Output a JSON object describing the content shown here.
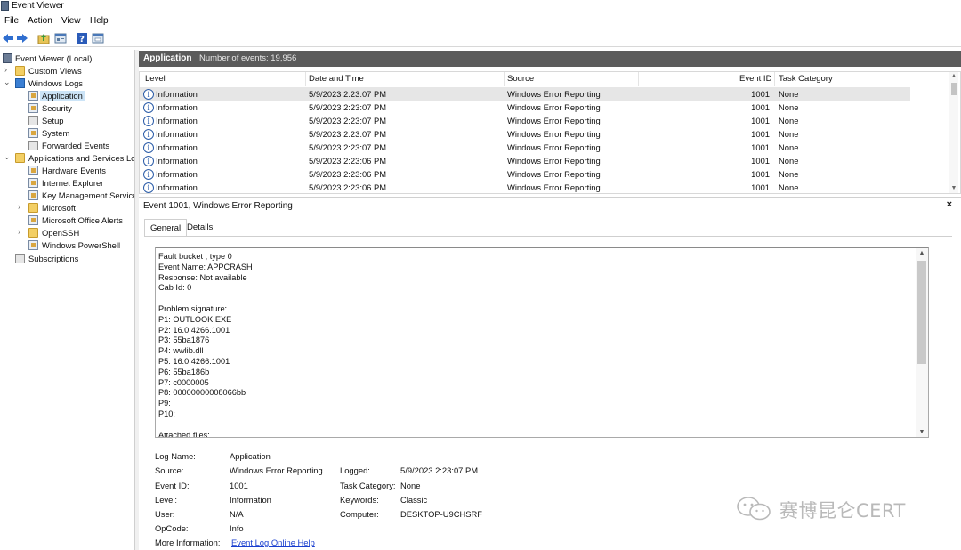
{
  "window": {
    "title": "Event Viewer"
  },
  "menu": [
    "File",
    "Action",
    "View",
    "Help"
  ],
  "toolbar": [
    "back-icon",
    "forward-icon",
    "folder-up-icon",
    "properties-icon",
    "help-icon",
    "show-pane-icon"
  ],
  "tree": {
    "root": "Event Viewer (Local)",
    "custom_views": "Custom Views",
    "windows_logs": "Windows Logs",
    "windows_logs_items": [
      "Application",
      "Security",
      "Setup",
      "System",
      "Forwarded Events"
    ],
    "apps_services": "Applications and Services Log",
    "apps_services_items": [
      "Hardware Events",
      "Internet Explorer",
      "Key Management Service",
      "Microsoft",
      "Microsoft Office Alerts",
      "OpenSSH",
      "Windows PowerShell"
    ],
    "subscriptions": "Subscriptions",
    "selected": "Application"
  },
  "list_header": {
    "title": "Application",
    "count": "Number of events: 19,956"
  },
  "columns": [
    "Level",
    "Date and Time",
    "Source",
    "Event ID",
    "Task Category"
  ],
  "rows": [
    {
      "level": "Information",
      "datetime": "5/9/2023 2:23:07 PM",
      "source": "Windows Error Reporting",
      "event_id": "1001",
      "task": "None"
    },
    {
      "level": "Information",
      "datetime": "5/9/2023 2:23:07 PM",
      "source": "Windows Error Reporting",
      "event_id": "1001",
      "task": "None"
    },
    {
      "level": "Information",
      "datetime": "5/9/2023 2:23:07 PM",
      "source": "Windows Error Reporting",
      "event_id": "1001",
      "task": "None"
    },
    {
      "level": "Information",
      "datetime": "5/9/2023 2:23:07 PM",
      "source": "Windows Error Reporting",
      "event_id": "1001",
      "task": "None"
    },
    {
      "level": "Information",
      "datetime": "5/9/2023 2:23:07 PM",
      "source": "Windows Error Reporting",
      "event_id": "1001",
      "task": "None"
    },
    {
      "level": "Information",
      "datetime": "5/9/2023 2:23:06 PM",
      "source": "Windows Error Reporting",
      "event_id": "1001",
      "task": "None"
    },
    {
      "level": "Information",
      "datetime": "5/9/2023 2:23:06 PM",
      "source": "Windows Error Reporting",
      "event_id": "1001",
      "task": "None"
    },
    {
      "level": "Information",
      "datetime": "5/9/2023 2:23:06 PM",
      "source": "Windows Error Reporting",
      "event_id": "1001",
      "task": "None"
    }
  ],
  "detail": {
    "title": "Event 1001, Windows Error Reporting",
    "close": "×",
    "tabs": [
      "General",
      "Details"
    ],
    "description": [
      "Fault bucket , type 0",
      "Event Name: APPCRASH",
      "Response: Not available",
      "Cab Id: 0",
      "",
      "Problem signature:",
      "P1: OUTLOOK.EXE",
      "P2: 16.0.4266.1001",
      "P3: 55ba1876",
      "P4: wwlib.dll",
      "P5: 16.0.4266.1001",
      "P6: 55ba186b",
      "P7: c0000005",
      "P8: 00000000008066bb",
      "P9:",
      "P10:",
      "",
      "Attached files:"
    ],
    "fields": {
      "log_name_label": "Log Name:",
      "log_name": "Application",
      "source_label": "Source:",
      "source": "Windows Error Reporting",
      "logged_label": "Logged:",
      "logged": "5/9/2023 2:23:07 PM",
      "event_id_label": "Event ID:",
      "event_id": "1001",
      "task_category_label": "Task Category:",
      "task_category": "None",
      "level_label": "Level:",
      "level": "Information",
      "keywords_label": "Keywords:",
      "keywords": "Classic",
      "user_label": "User:",
      "user": "N/A",
      "computer_label": "Computer:",
      "computer": "DESKTOP-U9CHSRF",
      "opcode_label": "OpCode:",
      "opcode": "Info",
      "more_info_label": "More Information:",
      "more_info_link": "Event Log Online Help"
    }
  },
  "watermark": {
    "text": "赛博昆仑CERT"
  }
}
